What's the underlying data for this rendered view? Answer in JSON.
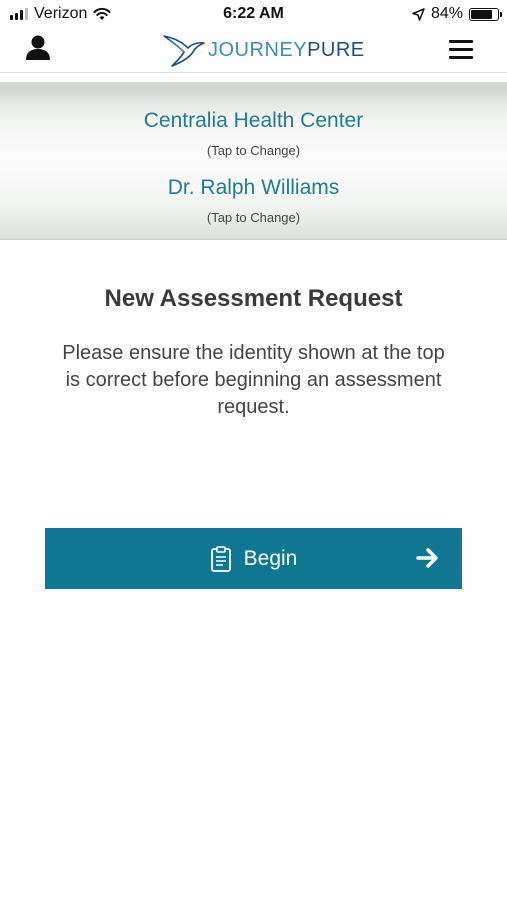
{
  "status": {
    "carrier": "Verizon",
    "time": "6:22 AM",
    "battery": "84%"
  },
  "header": {
    "logo_part1": "JOURNEY",
    "logo_part2": "PURE"
  },
  "banner": {
    "facility": "Centralia Health Center",
    "facility_hint": "(Tap to Change)",
    "doctor": "Dr. Ralph Williams",
    "doctor_hint": "(Tap to Change)"
  },
  "main": {
    "title": "New Assessment Request",
    "description": "Please ensure the identity shown at the top is correct before beginning an assessment request.",
    "begin_label": "Begin"
  },
  "colors": {
    "accent": "#0f7791",
    "link": "#1f7a93"
  }
}
